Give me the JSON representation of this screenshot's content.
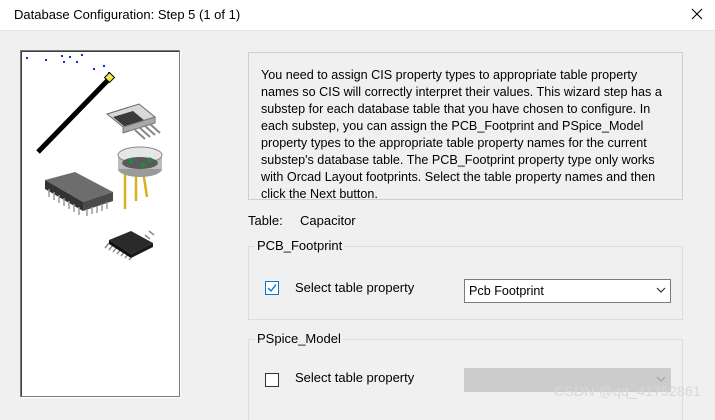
{
  "window": {
    "title": "Database Configuration: Step 5 (1 of 1)",
    "close_icon": "close-icon"
  },
  "description": "You need to assign CIS property types to appropriate table property names so CIS will correctly interpret their values. This wizard step has a substep for each database table that you have chosen to configure. In each substep, you can assign the PCB_Footprint and PSpice_Model property types to the appropriate table property names for the current substep's database table. The PCB_Footprint property type only works with Orcad Layout footprints. Select the table property names and then click the Next button.",
  "table": {
    "label": "Table:",
    "value": "Capacitor"
  },
  "pcb_footprint": {
    "group_title": "PCB_Footprint",
    "checkbox_label": "Select table property",
    "checked": true,
    "selected_value": "Pcb Footprint"
  },
  "pspice_model": {
    "group_title": "PSpice_Model",
    "checkbox_label": "Select table property",
    "checked": false,
    "selected_value": ""
  },
  "watermark": "CSDN @qq_41752861",
  "colors": {
    "accent": "#0078d7",
    "disabled_field": "#cccccc"
  }
}
